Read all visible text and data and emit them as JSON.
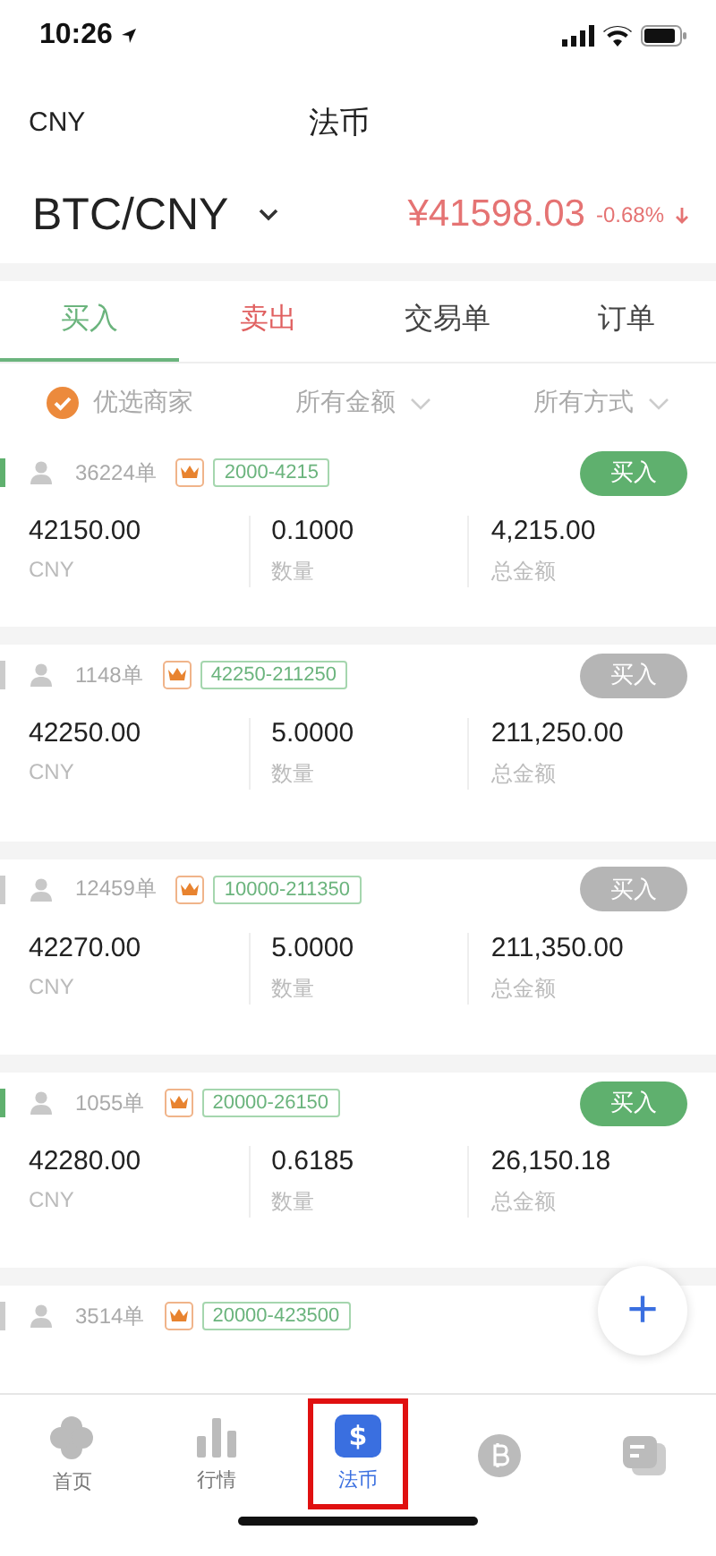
{
  "status_bar": {
    "time": "10:26"
  },
  "header": {
    "currency": "CNY",
    "title": "法币"
  },
  "market": {
    "pair": "BTC/CNY",
    "price": "¥41598.03",
    "change": "-0.68%"
  },
  "tabs": [
    {
      "label": "买入",
      "selected": true,
      "color": "#6bb47d"
    },
    {
      "label": "卖出",
      "selected": false,
      "color": "#e06060"
    },
    {
      "label": "交易单",
      "selected": false,
      "color": "#444444"
    },
    {
      "label": "订单",
      "selected": false,
      "color": "#444444"
    }
  ],
  "filters": [
    {
      "kind": "check",
      "label": "优选商家",
      "checked": true
    },
    {
      "kind": "dropdown",
      "label": "所有金额"
    },
    {
      "kind": "dropdown",
      "label": "所有方式"
    }
  ],
  "offers": [
    {
      "orders": "36224单",
      "range": "2000-4215",
      "button": "买入",
      "available": true,
      "cells": [
        {
          "value": "42150.00",
          "label": "CNY"
        },
        {
          "value": "0.1000",
          "label": "数量"
        },
        {
          "value": "4,215.00",
          "label": "总金额"
        }
      ]
    },
    {
      "orders": "1148单",
      "range": "42250-211250",
      "button": "买入",
      "available": false,
      "cells": [
        {
          "value": "42250.00",
          "label": "CNY"
        },
        {
          "value": "5.0000",
          "label": "数量"
        },
        {
          "value": "211,250.00",
          "label": "总金额"
        }
      ]
    },
    {
      "orders": "12459单",
      "range": "10000-211350",
      "button": "买入",
      "available": false,
      "cells": [
        {
          "value": "42270.00",
          "label": "CNY"
        },
        {
          "value": "5.0000",
          "label": "数量"
        },
        {
          "value": "211,350.00",
          "label": "总金额"
        }
      ]
    },
    {
      "orders": "1055单",
      "range": "20000-26150",
      "button": "买入",
      "available": true,
      "cells": [
        {
          "value": "42280.00",
          "label": "CNY"
        },
        {
          "value": "0.6185",
          "label": "数量"
        },
        {
          "value": "26,150.18",
          "label": "总金额"
        }
      ]
    },
    {
      "orders": "3514单",
      "range": "20000-423500",
      "available": false
    }
  ],
  "fab": {
    "label": "+"
  },
  "tab_bar": [
    {
      "kind": "home",
      "label": "首页",
      "selected": false,
      "highlighted": false
    },
    {
      "kind": "market",
      "label": "行情",
      "selected": false,
      "highlighted": false
    },
    {
      "kind": "fiat",
      "icon": "$",
      "label": "法币",
      "selected": true,
      "highlighted": true
    },
    {
      "kind": "coin",
      "selected": false,
      "highlighted": false
    },
    {
      "kind": "assets",
      "selected": false,
      "highlighted": false
    }
  ]
}
